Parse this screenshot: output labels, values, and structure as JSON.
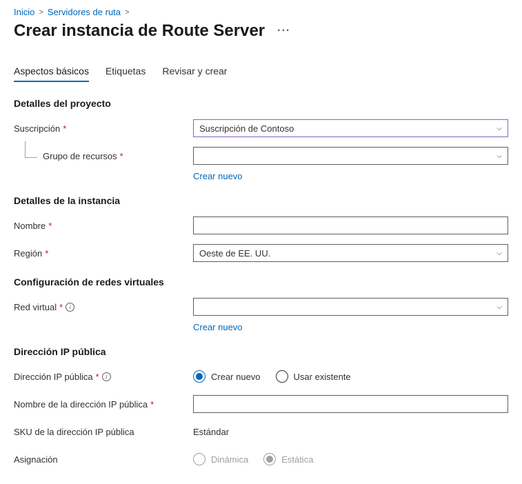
{
  "breadcrumb": {
    "home": "Inicio",
    "servers": "Servidores de ruta"
  },
  "page": {
    "title": "Crear instancia de Route Server"
  },
  "tabs": {
    "basics": "Aspectos básicos",
    "tags": "Etiquetas",
    "review": "Revisar y crear"
  },
  "sections": {
    "project": "Detalles del proyecto",
    "instance": "Detalles de la instancia",
    "vnet": "Configuración de redes virtuales",
    "publicip": "Dirección IP pública"
  },
  "fields": {
    "subscription": {
      "label": "Suscripción",
      "value": "Suscripción de Contoso"
    },
    "resource_group": {
      "label": "Grupo de recursos",
      "value": "",
      "create_new": "Crear nuevo"
    },
    "name": {
      "label": "Nombre",
      "value": ""
    },
    "region": {
      "label": "Región",
      "value": "Oeste de EE. UU."
    },
    "vnet": {
      "label": "Red virtual",
      "value": "",
      "create_new": "Crear nuevo"
    },
    "public_ip": {
      "label": "Dirección IP pública",
      "option_new": "Crear nuevo",
      "option_existing": "Usar existente"
    },
    "public_ip_name": {
      "label": "Nombre de la dirección IP pública",
      "value": ""
    },
    "public_ip_sku": {
      "label": "SKU de la dirección IP pública",
      "value": "Estándar"
    },
    "assignment": {
      "label": "Asignación",
      "option_dynamic": "Dinámica",
      "option_static": "Estática"
    }
  }
}
